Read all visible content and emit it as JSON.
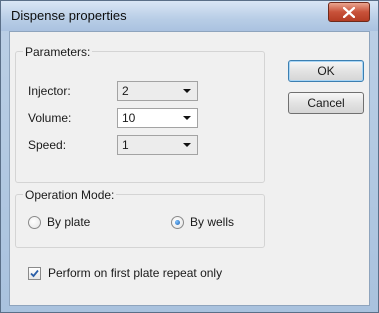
{
  "window": {
    "title": "Dispense properties"
  },
  "parameters": {
    "group_label": "Parameters:",
    "injector": {
      "label": "Injector:",
      "value": "2"
    },
    "volume": {
      "label": "Volume:",
      "value": "10"
    },
    "speed": {
      "label": "Speed:",
      "value": "1"
    }
  },
  "buttons": {
    "ok": "OK",
    "cancel": "Cancel"
  },
  "operation_mode": {
    "group_label": "Operation Mode:",
    "options": [
      {
        "label": "By plate",
        "selected": false
      },
      {
        "label": "By wells",
        "selected": true
      }
    ]
  },
  "repeat_checkbox": {
    "label": "Perform on first plate repeat only",
    "checked": true
  },
  "icons": {
    "close": "close-icon",
    "dropdown": "chevron-down-icon"
  }
}
